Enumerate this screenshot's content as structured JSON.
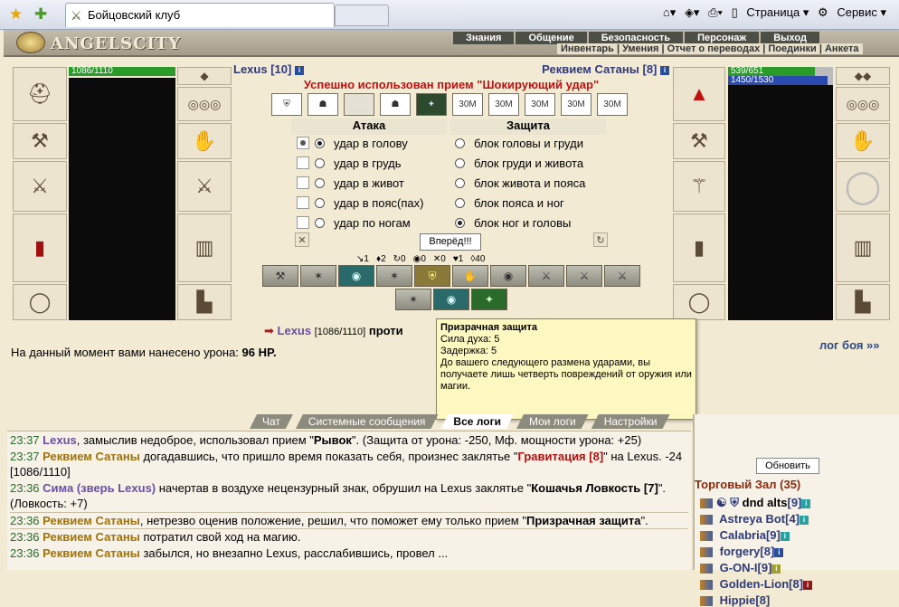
{
  "browser": {
    "tab_title": "Бойцовский клуб",
    "page_menu": "Страница",
    "service_menu": "Сервис"
  },
  "site": {
    "logo": "ANGELSCITY",
    "menu_top": [
      "Знания",
      "Общение",
      "Безопасность",
      "Персонаж",
      "Выход"
    ],
    "menu_sub": "Инвентарь | Умения | Отчет о переводах | Поединки | Анкета"
  },
  "player": {
    "name": "Lexus",
    "level": "[10]",
    "hp": "1086/1110",
    "hp_fraction": 0.98
  },
  "enemy": {
    "name": "Реквием Сатаны",
    "level": "[8]",
    "hp": "539/651",
    "mana": "1450/1530",
    "hp_fraction": 0.83,
    "mana_fraction": 0.95
  },
  "battle": {
    "notice": "Успешно использован прием \"Шокирующий удар\"",
    "priem_labels": [
      "30М",
      "30М",
      "30М",
      "30М",
      "30М"
    ],
    "attack_title": "Атака",
    "defense_title": "Защита",
    "attacks": [
      "удар в голову",
      "удар в грудь",
      "удар в живот",
      "удар в пояс(пах)",
      "удар по ногам"
    ],
    "blocks": [
      "блок головы и груди",
      "блок груди и живота",
      "блок живота и пояса",
      "блок пояса и ног",
      "блок ног и головы"
    ],
    "go_button": "Вперёд!!!",
    "counters": [
      "1",
      "2",
      "0",
      "0",
      "0",
      "1",
      "40"
    ],
    "target_line_prefix": "Lexus",
    "target_line_hp": "[1086/1110]",
    "target_line_suffix": "проти",
    "damage_text": "На данный момент вами нанесено урона:",
    "damage_value": "96 HP.",
    "log_link": "лог боя »»"
  },
  "tooltip": {
    "title": "Призрачная защита",
    "line1": "Сила духа: 5",
    "line2": "Задержка: 5",
    "desc": "До вашего следующего размена ударами, вы получаете лишь четверть повреждений от оружия или магии."
  },
  "chat_tabs": [
    "Чат",
    "Системные сообщения",
    "Все логи",
    "Мои логи",
    "Настройки"
  ],
  "chat": [
    {
      "t": "23:37",
      "a": "Lexus",
      "x": ", замыслив недоброе, использовал прием \"",
      "b": "Рывок",
      "y": "\". (Защита от урона: -250, Мф. мощности урона: +25)"
    },
    {
      "t": "23:37",
      "a": "Реквием Сатаны",
      "x": " догадавшись, что пришло время показать себя, произнес заклятье \"",
      "b": "Гравитация [8]",
      "y": "\" на Lexus. -24 [1086/1110]"
    },
    {
      "t": "23:36",
      "a": "Сима (зверь Lexus)",
      "x": " начертав в воздухе нецензурный знак, обрушил на Lexus заклятье \"",
      "b": "Кошачья Ловкость [7]",
      "y": "\". (Ловкость: +7)"
    },
    {
      "t": "23:36",
      "a": "Реквием Сатаны",
      "x": ", нетрезво оценив положение, решил, что поможет ему только прием \"",
      "b": "Призрачная защита",
      "y": "\"."
    },
    {
      "t": "23:36",
      "a": "Реквием Сатаны",
      "x": " потратил свой ход на магию.",
      "b": "",
      "y": ""
    },
    {
      "t": "23:36",
      "a": "Реквием Сатаны",
      "x": " забылся, но внезапно Lexus, расслабившись, провел ...",
      "b": "",
      "y": ""
    }
  ],
  "sidebar": {
    "refresh": "Обновить",
    "hall_title": "Торговый Зал (35)",
    "users": [
      {
        "name": "dnd alts",
        "lvl": "[9]"
      },
      {
        "name": "Astreya Bot",
        "lvl": "[4]"
      },
      {
        "name": "Calabria",
        "lvl": "[9]"
      },
      {
        "name": "forgery",
        "lvl": "[8]"
      },
      {
        "name": "G-ON-I",
        "lvl": "[9]"
      },
      {
        "name": "Golden-Lion",
        "lvl": "[8]"
      },
      {
        "name": "Hippie",
        "lvl": "[8]"
      }
    ]
  }
}
